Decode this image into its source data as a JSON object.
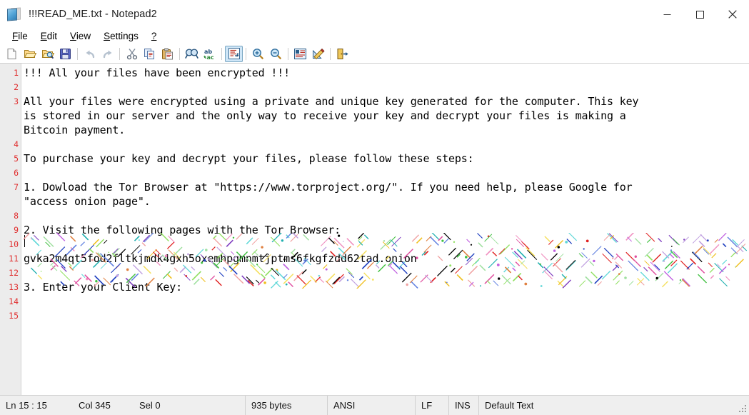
{
  "window": {
    "title": "!!!READ_ME.txt - Notepad2",
    "icon": "notepad2-document-icon",
    "controls": [
      {
        "name": "minimize-button",
        "glyph": "minimize-icon"
      },
      {
        "name": "maximize-button",
        "glyph": "maximize-icon"
      },
      {
        "name": "close-button",
        "glyph": "close-icon"
      }
    ]
  },
  "menubar": {
    "items": [
      {
        "accel": "F",
        "rest": "ile"
      },
      {
        "accel": "E",
        "rest": "dit"
      },
      {
        "accel": "V",
        "rest": "iew"
      },
      {
        "accel": "S",
        "rest": "ettings"
      },
      {
        "accel": "?",
        "rest": ""
      }
    ]
  },
  "toolbar": {
    "buttons": [
      {
        "name": "new-file-icon",
        "active": false
      },
      {
        "name": "open-file-icon",
        "active": false
      },
      {
        "name": "browse-file-icon",
        "active": false
      },
      {
        "name": "save-file-icon",
        "active": false
      },
      {
        "sep": true
      },
      {
        "name": "undo-icon",
        "active": false
      },
      {
        "name": "redo-icon",
        "active": false
      },
      {
        "sep": true
      },
      {
        "name": "cut-icon",
        "active": false
      },
      {
        "name": "copy-icon",
        "active": false
      },
      {
        "name": "paste-icon",
        "active": false
      },
      {
        "sep": true
      },
      {
        "name": "find-icon",
        "active": false
      },
      {
        "name": "replace-icon",
        "active": false
      },
      {
        "sep": true
      },
      {
        "name": "word-wrap-icon",
        "active": true
      },
      {
        "sep": true
      },
      {
        "name": "zoom-in-icon",
        "active": false
      },
      {
        "name": "zoom-out-icon",
        "active": false
      },
      {
        "sep": true
      },
      {
        "name": "scheme-icon",
        "active": false
      },
      {
        "name": "edit-scheme-icon",
        "active": false
      },
      {
        "sep": true
      },
      {
        "name": "exit-icon",
        "active": false
      }
    ]
  },
  "editor": {
    "line_numbers": [
      "1",
      "2",
      "3",
      "",
      "",
      "4",
      "5",
      "6",
      "7",
      "",
      "8",
      "9",
      "10",
      "11",
      "12",
      "13",
      "14",
      "15"
    ],
    "lines": [
      "!!! All your files have been encrypted !!!",
      "",
      "All your files were encrypted using a private and unique key generated for the computer. This key",
      "is stored in our server and the only way to receive your key and decrypt your files is making a",
      "Bitcoin payment.",
      "",
      "To purchase your key and decrypt your files, please follow these steps:",
      "",
      "1. Dowload the Tor Browser at \"https://www.torproject.org/\". If you need help, please Google for",
      "\"access onion page\".",
      "",
      "2. Visit the following pages with the Tor Browser:",
      "",
      "gvka2m4qt5fod2fltkjmdk4gxh5oxemhpgmnmtjptms6fkgfzdd62tad.onion",
      "",
      "3. Enter your Client Key:",
      "",
      ""
    ],
    "onion_address": "gvka2m4qt5fod2fltkjmdk4gxh5oxemhpgmnmtjptms6fkgfzdd62tad.onion",
    "client_key_block": "unreadable-multicolor-binary-glyph-block",
    "gutter_color": "#e03030",
    "text_color": "#000000"
  },
  "statusbar": {
    "line_col": "Ln 15 : 15",
    "col": "Col 345",
    "selection": "Sel 0",
    "size": "935 bytes",
    "encoding": "ANSI",
    "line_ending": "LF",
    "insert_mode": "INS",
    "scheme": "Default Text"
  }
}
